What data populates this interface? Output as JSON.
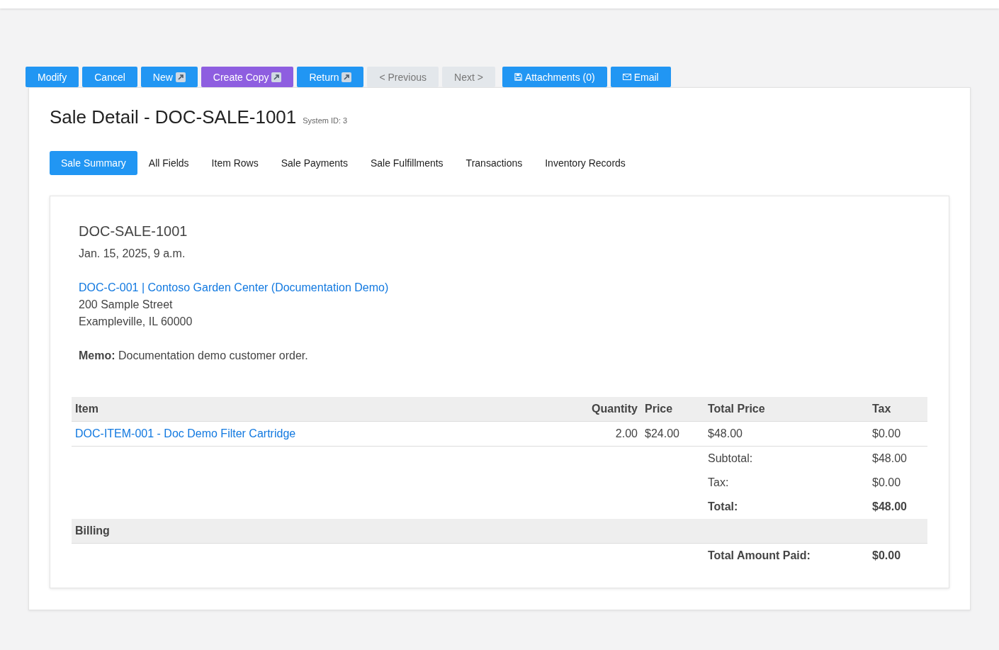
{
  "actions": [
    {
      "label": "Modify",
      "kind": "primary",
      "disabled": false
    },
    {
      "label": "Cancel",
      "kind": "primary",
      "disabled": false
    },
    {
      "label": "New",
      "kind": "primary",
      "disabled": false
    },
    {
      "label": "Create Copy",
      "kind": "accent",
      "disabled": false
    },
    {
      "label": "Return",
      "kind": "primary",
      "disabled": false
    },
    {
      "label": "< Previous",
      "kind": "primary",
      "disabled": true
    },
    {
      "label": "Next >",
      "kind": "primary",
      "disabled": true
    },
    {
      "label": "Attachments (0)",
      "kind": "primary",
      "disabled": false
    },
    {
      "label": "Email",
      "kind": "primary",
      "disabled": false
    }
  ],
  "title": "Sale Detail - DOC-SALE-1001",
  "system_id": "System ID: 3",
  "tabs": [
    {
      "label": "Sale Summary",
      "selected": true
    },
    {
      "label": "All Fields",
      "selected": false
    },
    {
      "label": "Item Rows",
      "selected": false
    },
    {
      "label": "Sale Payments",
      "selected": false
    },
    {
      "label": "Sale Fulfillments",
      "selected": false
    },
    {
      "label": "Transactions",
      "selected": false
    },
    {
      "label": "Inventory Records",
      "selected": false
    }
  ],
  "summary": {
    "doc_number": "DOC-SALE-1001",
    "date": "Jan. 15, 2025, 9 a.m.",
    "customer_link": "DOC-C-001 | Contoso Garden Center (Documentation Demo)",
    "address": [
      "200 Sample Street",
      "Exampleville, IL 60000"
    ],
    "memo": "**Memo:** Documentation demo customer order."
  },
  "table": {
    "columns": [
      "Item",
      "Quantity",
      "Price",
      "Total Price",
      "Tax"
    ],
    "rows": [
      {
        "item": "DOC-ITEM-001 - Doc Demo Filter Cartridge",
        "quantity": "2.00",
        "price": "$24.00",
        "total_price": "$48.00",
        "tax": "$0.00"
      }
    ],
    "totals": [
      {
        "label": "Subtotal:",
        "value": "$48.00"
      },
      {
        "label": "Tax:",
        "value": "$0.00"
      },
      {
        "label": "Total:",
        "value": "$48.00"
      }
    ],
    "billing_heading": "Billing",
    "billing": [
      {
        "label": "Total Amount Paid:",
        "value": "$0.00"
      }
    ]
  }
}
